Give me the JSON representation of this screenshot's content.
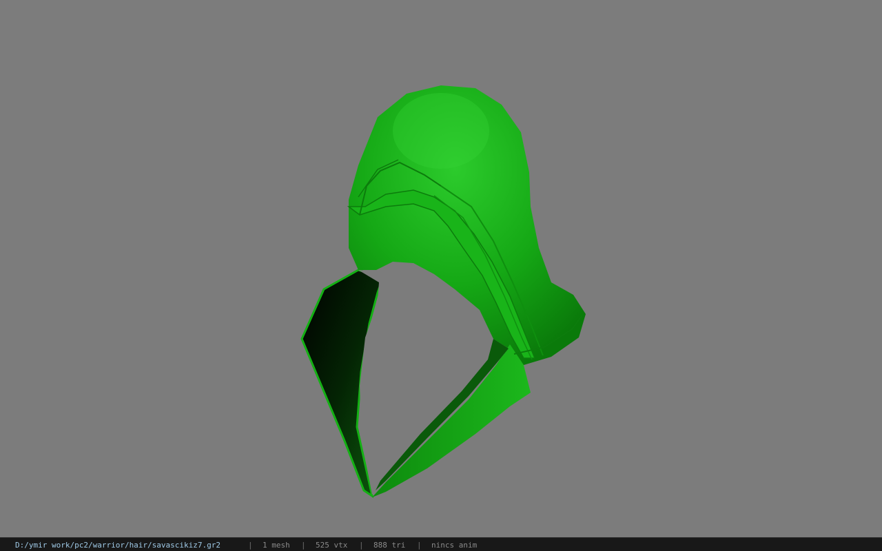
{
  "status_bar": {
    "file_path": "D:/ymir work/pc2/warrior/hair/savascikiz7.gr2",
    "separator": "|",
    "mesh_count": "1 mesh",
    "vertex_count": "525 vtx",
    "triangle_count": "888 tri",
    "animation_status": "nincs anim"
  },
  "viewport": {
    "background_color": "#7c7c7c",
    "model": "green-hood-mesh",
    "model_color": "#1fb01f"
  }
}
